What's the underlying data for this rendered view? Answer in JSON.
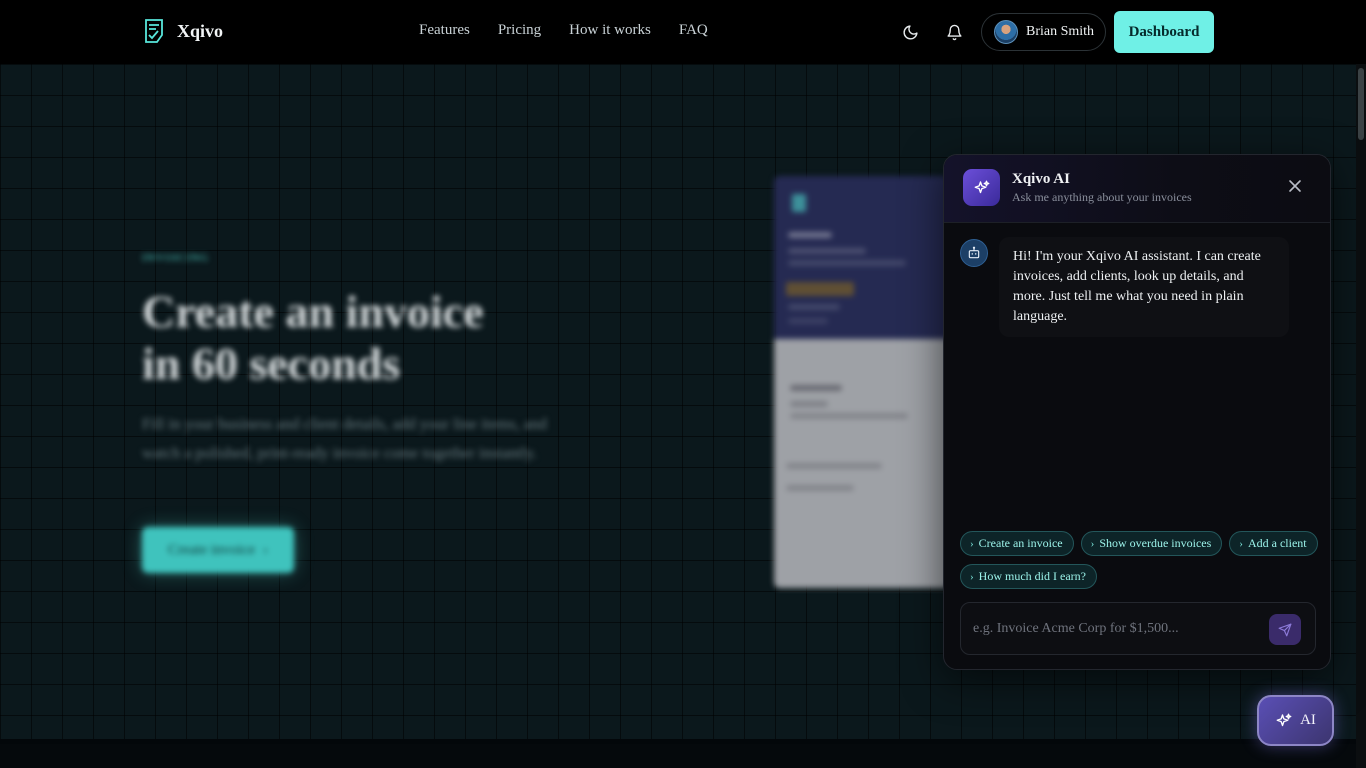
{
  "nav": {
    "brand": "Xqivo",
    "links": [
      "Features",
      "Pricing",
      "How it works",
      "FAQ"
    ],
    "user_name": "Brian Smith",
    "dashboard_label": "Dashboard"
  },
  "hero": {
    "eyebrow": "INVOICING",
    "title_line1": "Create an invoice",
    "title_line2": "in 60 seconds",
    "subtitle": "Fill in your business and client details, add your line items, and watch a polished, print-ready invoice come together instantly.",
    "cta_label": "Create invoice"
  },
  "ai_panel": {
    "title": "Xqivo AI",
    "subtitle": "Ask me anything about your invoices",
    "greeting": "Hi! I'm your Xqivo AI assistant. I can create invoices, add clients, look up details, and more. Just tell me what you need in plain language.",
    "suggestions": [
      "Create an invoice",
      "Show overdue invoices",
      "Add a client",
      "How much did I earn?"
    ],
    "input_placeholder": "e.g. Invoice Acme Corp for $1,500..."
  },
  "fab": {
    "label": "AI"
  },
  "colors": {
    "accent": "#6ff0e6",
    "ai_purple": "#6c4fd9",
    "background": "#05090c"
  }
}
